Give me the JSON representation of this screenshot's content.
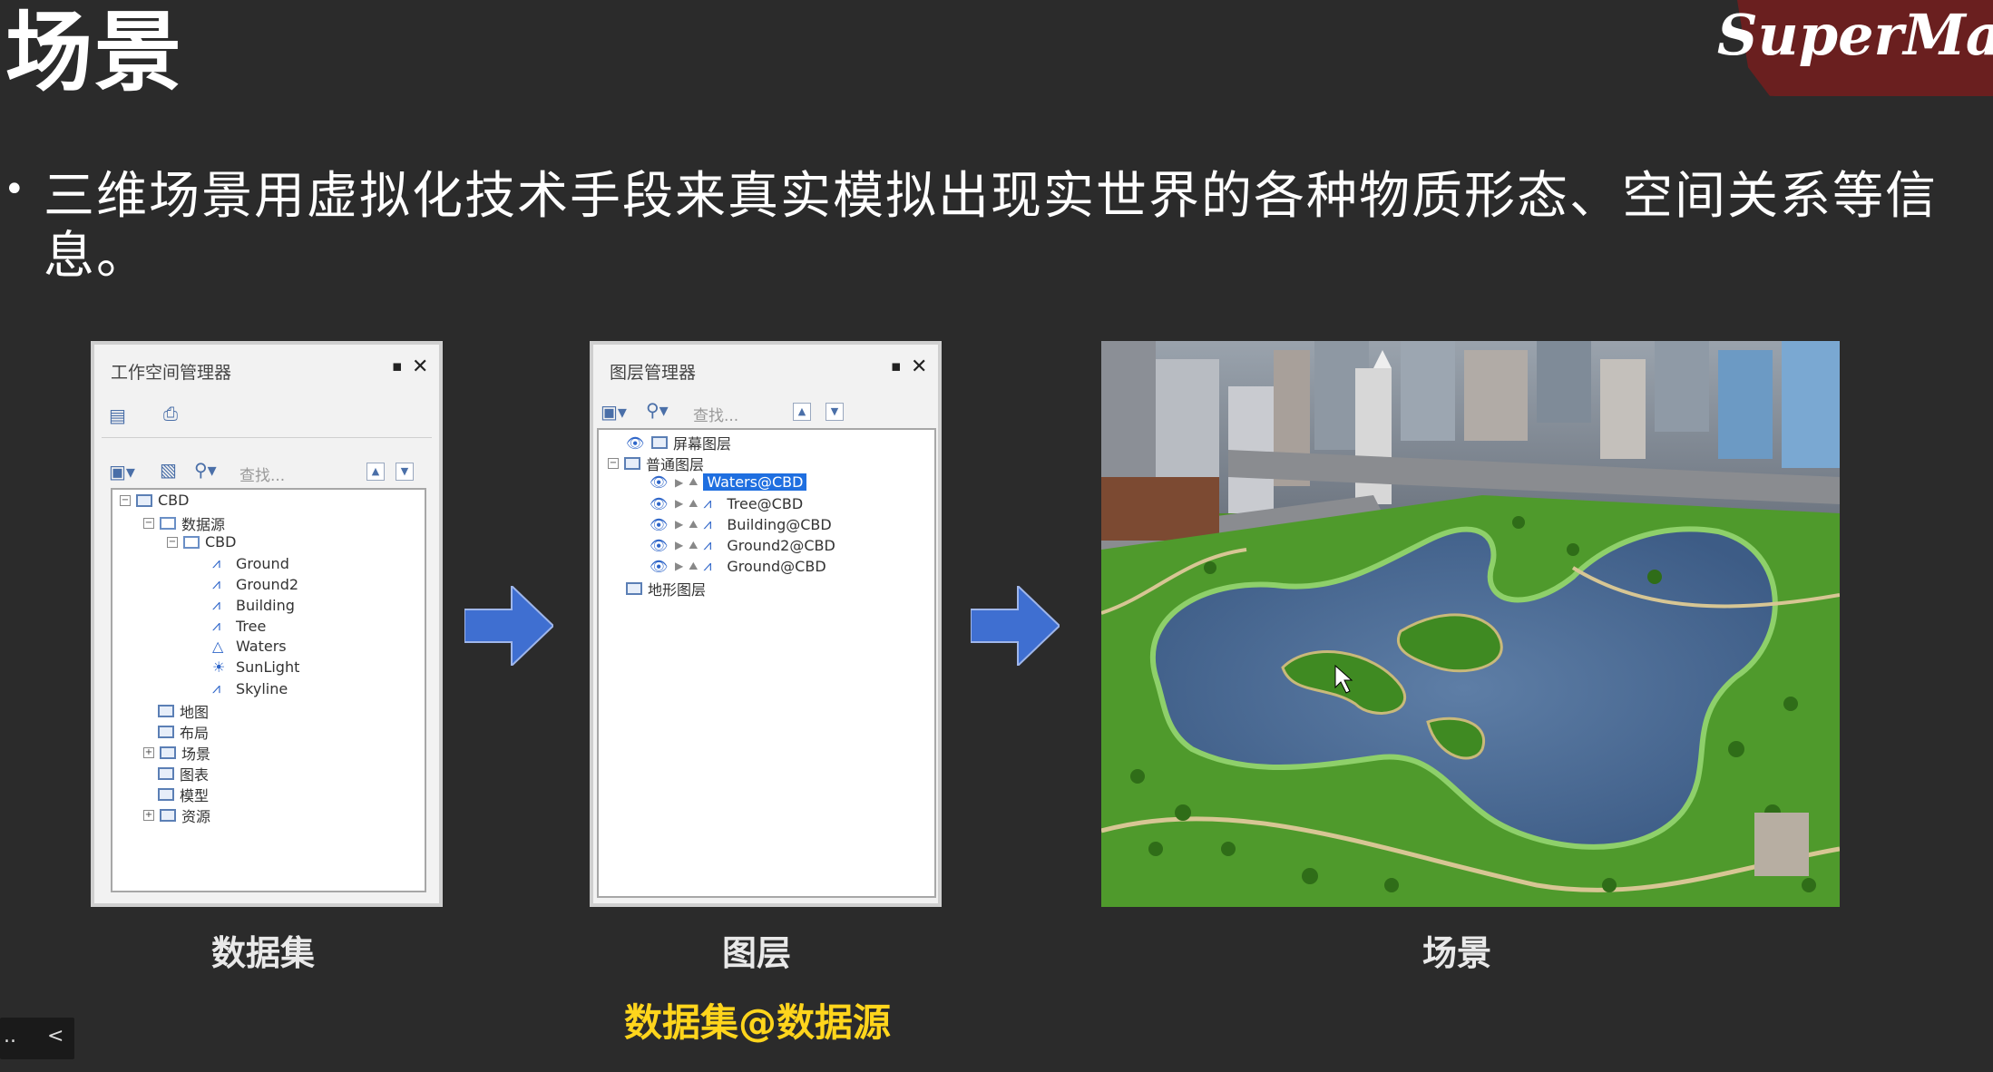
{
  "slide": {
    "title": "场景",
    "brand": "SuperMa",
    "bullet": "三维场景用虚拟化技术手段来真实模拟出现实世界的各种物质形态、空间关系等信息。"
  },
  "workspace_panel": {
    "title": "工作空间管理器",
    "pin": "▪",
    "close": "✕",
    "search_placeholder": "查找...",
    "tree": [
      {
        "label": "CBD",
        "level": 0
      },
      {
        "label": "数据源",
        "level": 1
      },
      {
        "label": "CBD",
        "level": 2
      },
      {
        "label": "Ground",
        "level": 3
      },
      {
        "label": "Ground2",
        "level": 3
      },
      {
        "label": "Building",
        "level": 3
      },
      {
        "label": "Tree",
        "level": 3
      },
      {
        "label": "Waters",
        "level": 3
      },
      {
        "label": "SunLight",
        "level": 3
      },
      {
        "label": "Skyline",
        "level": 3
      },
      {
        "label": "地图",
        "level": 1
      },
      {
        "label": "布局",
        "level": 1
      },
      {
        "label": "场景",
        "level": 1
      },
      {
        "label": "图表",
        "level": 1
      },
      {
        "label": "模型",
        "level": 1
      },
      {
        "label": "资源",
        "level": 1
      }
    ]
  },
  "layer_panel": {
    "title": "图层管理器",
    "pin": "▪",
    "close": "✕",
    "search_placeholder": "查找...",
    "tree": [
      {
        "label": "屏幕图层",
        "level": 0
      },
      {
        "label": "普通图层",
        "level": 0
      },
      {
        "label": "Waters@CBD",
        "level": 1,
        "selected": true
      },
      {
        "label": "Tree@CBD",
        "level": 1
      },
      {
        "label": "Building@CBD",
        "level": 1
      },
      {
        "label": "Ground2@CBD",
        "level": 1
      },
      {
        "label": "Ground@CBD",
        "level": 1
      },
      {
        "label": "地形图层",
        "level": 0
      }
    ]
  },
  "captions": {
    "dataset": "数据集",
    "layer": "图层",
    "scene": "场景",
    "formula": "数据集@数据源"
  },
  "colors": {
    "background": "#2b2b2b",
    "arrow": "#3f6fd1",
    "formula": "#ffd51c",
    "brand": "#6a1f1f"
  },
  "player": {
    "more": "..",
    "back": "<"
  }
}
